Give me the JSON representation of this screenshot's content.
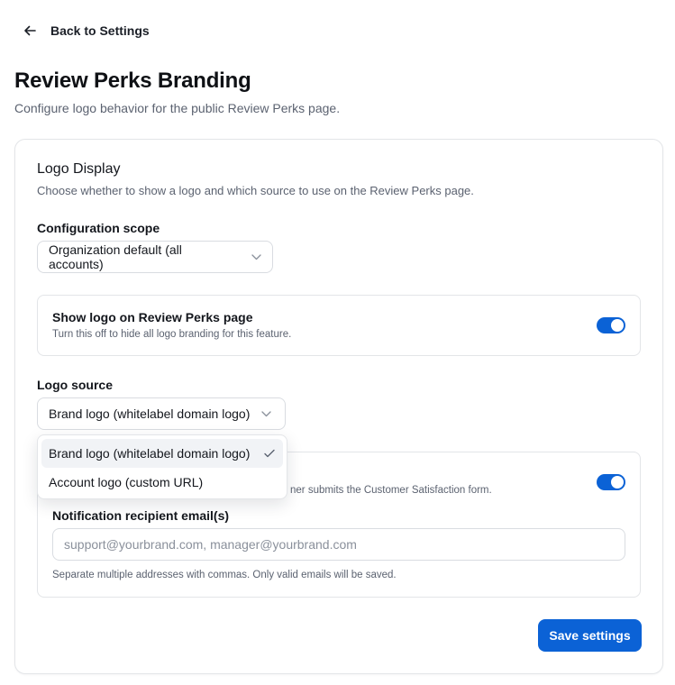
{
  "nav": {
    "back_label": "Back to Settings",
    "back_icon": "arrow-left-icon"
  },
  "page": {
    "title": "Review Perks Branding",
    "subtitle": "Configure logo behavior for the public Review Perks page."
  },
  "logo_display": {
    "title": "Logo Display",
    "description": "Choose whether to show a logo and which source to use on the Review Perks page.",
    "scope": {
      "label": "Configuration scope",
      "value": "Organization default (all accounts)"
    },
    "show_logo": {
      "title": "Show logo on Review Perks page",
      "description": "Turn this off to hide all logo branding for this feature.",
      "enabled": true
    },
    "logo_source": {
      "label": "Logo source",
      "value": "Brand logo (whitelabel domain logo)",
      "options": [
        {
          "label": "Brand logo (whitelabel domain logo)",
          "selected": true
        },
        {
          "label": "Account logo (custom URL)",
          "selected": false
        }
      ]
    },
    "notification": {
      "description_visible": "ner submits the Customer Satisfaction form.",
      "enabled": true,
      "email_label": "Notification recipient email(s)",
      "email_value": "",
      "email_placeholder": "support@yourbrand.com, manager@yourbrand.com",
      "helper": "Separate multiple addresses with commas. Only valid emails will be saved."
    },
    "save_label": "Save settings"
  },
  "colors": {
    "accent": "#0b62d6",
    "border": "#e3e5e8",
    "muted_text": "#5b6270"
  }
}
